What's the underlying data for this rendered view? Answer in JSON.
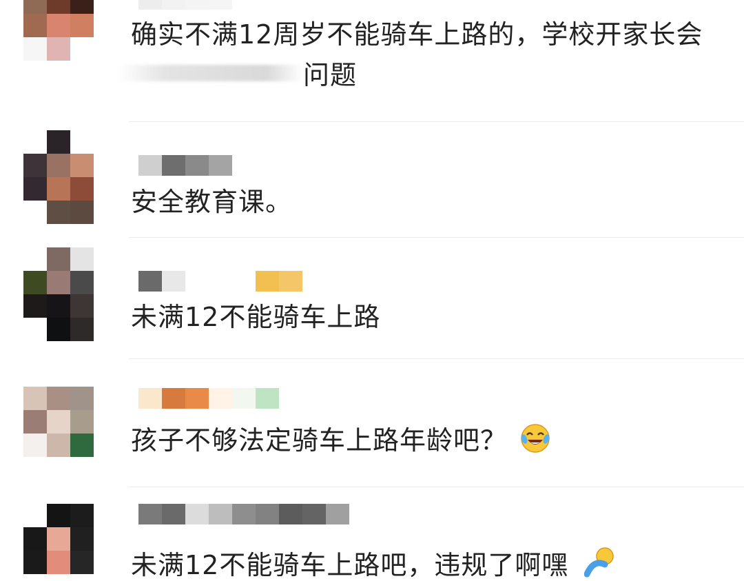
{
  "comments": [
    {
      "avatar": [
        "#8f6a55",
        "#6e3a2a",
        "#3a2018",
        "#a06a50",
        "#d9846e",
        "#d08060",
        "#f6f6f6",
        "#e0b4b2",
        "#ffffff"
      ],
      "name_blocks": [
        "#ededed",
        "#f2f2f2",
        "#f4f4f4",
        "#f5f5f5"
      ],
      "text": "确实不满12周岁不能骑车上路的，学校开家长会",
      "text_line2": "问题"
    },
    {
      "avatar": [
        "#ffffff",
        "#2a2428",
        "#ffffff",
        "#3d3338",
        "#9a7264",
        "#c98d72",
        "#322a30",
        "#b77456",
        "#8c4c38",
        "#ffffff",
        "#5e4e44",
        "#5c4a40"
      ],
      "name_blocks": [
        "#cfcfcf",
        "#6e6e6e",
        "#8a8a8a",
        "#a4a4a4"
      ],
      "text": "安全教育课。"
    },
    {
      "avatar": [
        "#ffffff",
        "#7e6a62",
        "#e4e4e4",
        "#3d4a22",
        "#9a7a74",
        "#4a4a4a",
        "#1e1a1a",
        "#171418",
        "#3e3634",
        "#ffffff",
        "#0f1012",
        "#2e2a2a"
      ],
      "name_blocks": [
        "#6a6a6a",
        "#e8e8e8",
        "#ffffff",
        "#ffffff",
        "#ffffff",
        "#f2c050",
        "#f4c668"
      ],
      "text": "未满12不能骑车上路"
    },
    {
      "avatar": [
        "#d8c4b6",
        "#a89084",
        "#a0938a",
        "#9a7e76",
        "#e6d4c8",
        "#a89c8c",
        "#f4f0ee",
        "#cdb6aa",
        "#2e6a3e"
      ],
      "name_blocks": [
        "#fbe8cc",
        "#d67a3e",
        "#e98a48",
        "#fff2e6",
        "#f2f8f0",
        "#bfe4c4"
      ],
      "text": "孩子不够法定骑车上路年龄吧？"
    },
    {
      "avatar": [
        "#ffffff",
        "#141414",
        "#1c1c1c",
        "#181818",
        "#e8a896",
        "#202020",
        "#1a1a1a",
        "#e28c7c",
        "#262626"
      ],
      "name_blocks": [
        "#7a7a7a",
        "#6a6a6a",
        "#dcdcdc",
        "#bdbdbd",
        "#8e8e8e",
        "#828282",
        "#5c5c5c",
        "#646464",
        "#a0a0a0"
      ],
      "text": "未满12不能骑车上路吧，违规了啊嘿"
    }
  ],
  "emojis": {
    "laughing_crying": "laughing-crying-emoji",
    "partial": "partial-emoji"
  }
}
